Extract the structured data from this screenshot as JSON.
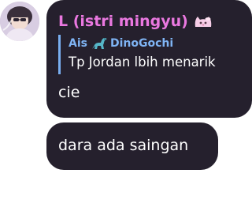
{
  "messages": [
    {
      "sender": "L (istri mingyu)",
      "sender_badge_icon": "cat-sticker-icon",
      "reply": {
        "author": "Ais",
        "author_badge_icon": "dinosaur-icon",
        "source": "DinoGochi",
        "text": "Tp Jordan lbih menarik"
      },
      "text": "cie"
    },
    {
      "text": "dara ada saingan"
    }
  ],
  "colors": {
    "bubble": "#25202d",
    "sender_name": "#ea78e0",
    "reply_accent": "#79aef0",
    "reply_name": "#7fb4f4",
    "text": "#ffffff",
    "background": "#ffffff"
  }
}
